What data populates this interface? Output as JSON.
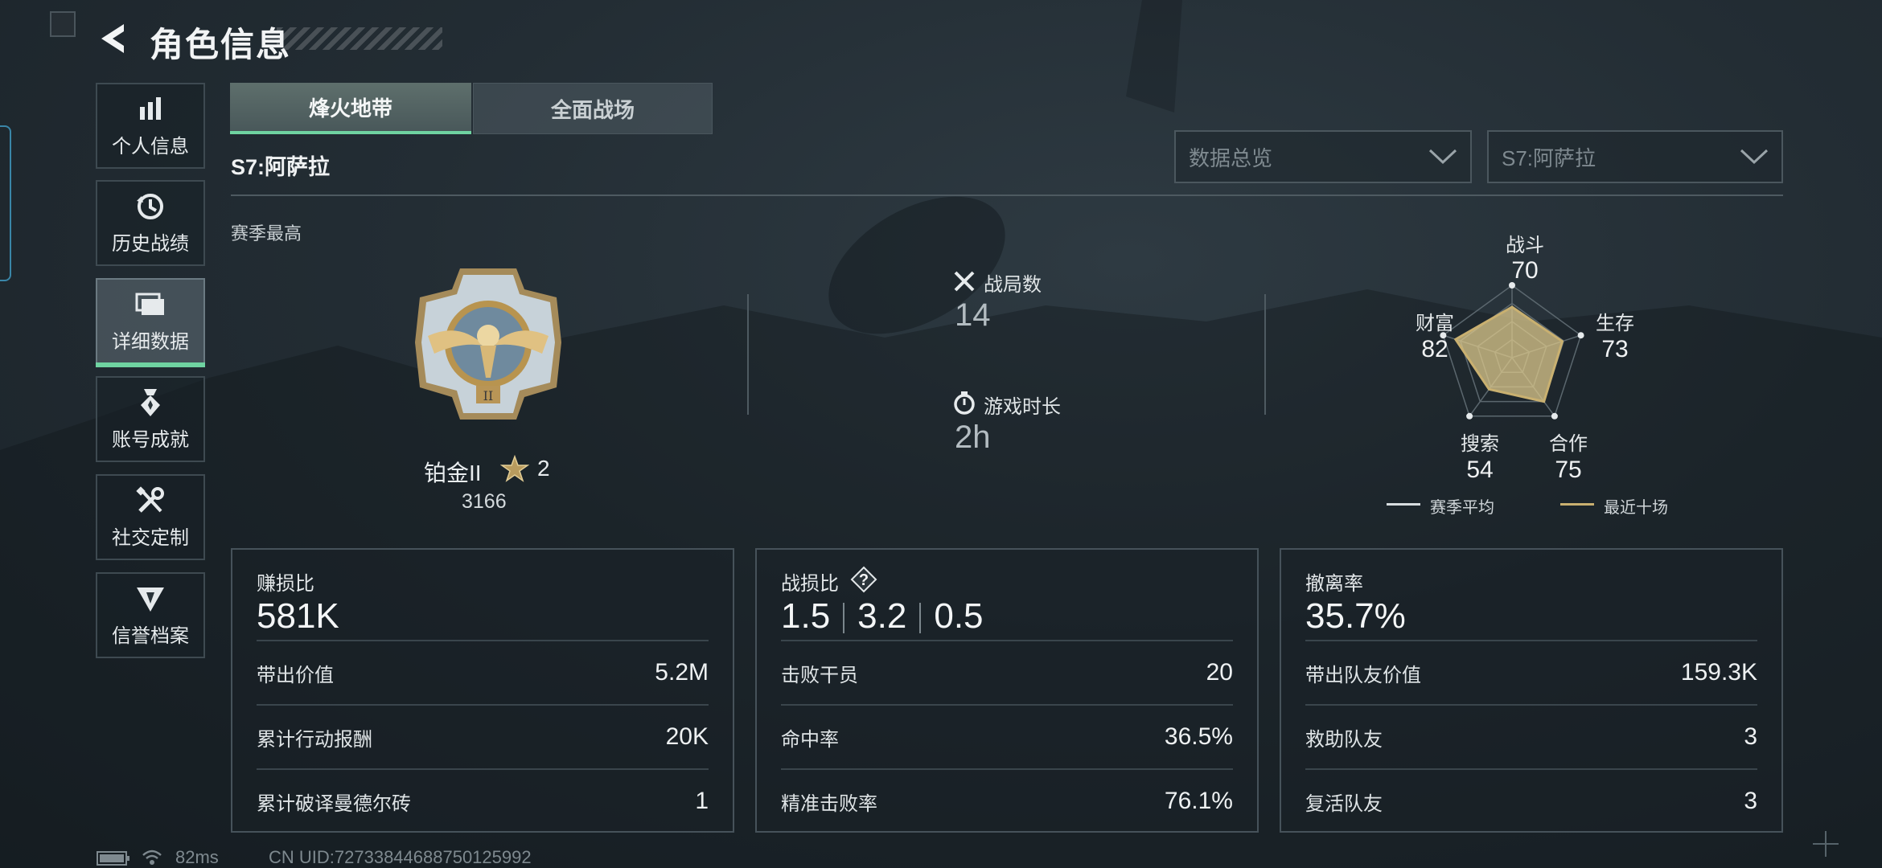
{
  "header": {
    "title": "角色信息"
  },
  "sidebar": {
    "items": [
      {
        "label": "个人信息"
      },
      {
        "label": "历史战绩"
      },
      {
        "label": "详细数据"
      },
      {
        "label": "账号成就"
      },
      {
        "label": "社交定制"
      },
      {
        "label": "信誉档案"
      }
    ],
    "active_index": 2
  },
  "tabs": {
    "active": "烽火地带",
    "inactive": "全面战场"
  },
  "season": {
    "label": "S7:阿萨拉"
  },
  "filters": {
    "overview": "数据总览",
    "season": "S7:阿萨拉"
  },
  "season_best": {
    "label": "赛季最高",
    "rank_name": "铂金II",
    "stars": "2",
    "score": "3166"
  },
  "match_stats": {
    "matches_label": "战局数",
    "matches_value": "14",
    "time_label": "游戏时长",
    "time_value": "2h"
  },
  "radar": {
    "axes": [
      {
        "label": "战斗",
        "value": "70",
        "num": 70
      },
      {
        "label": "生存",
        "value": "73",
        "num": 73
      },
      {
        "label": "合作",
        "value": "75",
        "num": 75
      },
      {
        "label": "搜索",
        "value": "54",
        "num": 54
      },
      {
        "label": "财富",
        "value": "82",
        "num": 82
      }
    ],
    "legend": {
      "season_avg": "赛季平均",
      "recent": "最近十场"
    },
    "colors": {
      "recent": "#c9b070",
      "season_avg": "#d8dde0"
    }
  },
  "cards": {
    "profit": {
      "label": "赚损比",
      "value": "581K",
      "rows": [
        {
          "label": "带出价值",
          "value": "5.2M"
        },
        {
          "label": "累计行动报酬",
          "value": "20K"
        },
        {
          "label": "累计破译曼德尔砖",
          "value": "1"
        }
      ]
    },
    "kd": {
      "label": "战损比",
      "values": [
        "1.5",
        "3.2",
        "0.5"
      ],
      "rows": [
        {
          "label": "击败干员",
          "value": "20"
        },
        {
          "label": "命中率",
          "value": "36.5%"
        },
        {
          "label": "精准击败率",
          "value": "76.1%"
        }
      ]
    },
    "extract": {
      "label": "撤离率",
      "value": "35.7%",
      "rows": [
        {
          "label": "带出队友价值",
          "value": "159.3K"
        },
        {
          "label": "救助队友",
          "value": "3"
        },
        {
          "label": "复活队友",
          "value": "3"
        }
      ]
    }
  },
  "footer": {
    "ping": "82ms",
    "uid": "CN UID:727338446887501259​92"
  },
  "accent": "#6fd3a1"
}
